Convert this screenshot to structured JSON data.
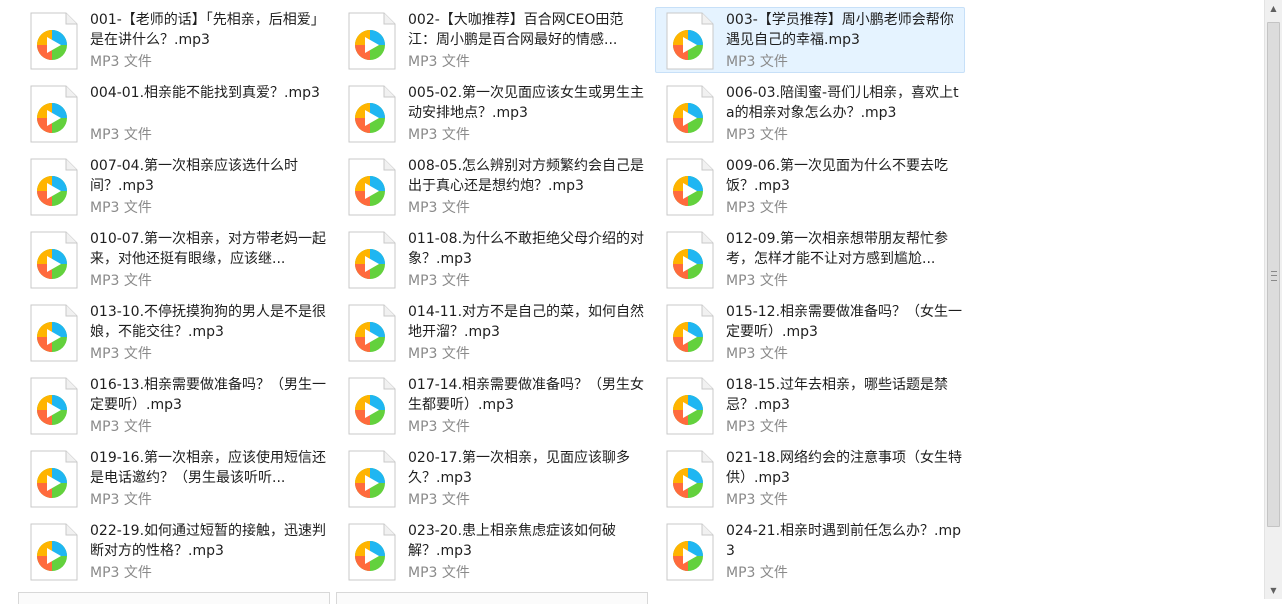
{
  "files": [
    {
      "name": "001-【老师的话】「先相亲，后相爱」是在讲什么？.mp3",
      "type": "MP3 文件",
      "selected": false
    },
    {
      "name": "002-【大咖推荐】百合网CEO田范江：周小鹏是百合网最好的情感...",
      "type": "MP3 文件",
      "selected": false
    },
    {
      "name": "003-【学员推荐】周小鹏老师会帮你遇见自己的幸福.mp3",
      "type": "MP3 文件",
      "selected": true
    },
    {
      "name": "004-01.相亲能不能找到真爱？.mp3",
      "type": "MP3 文件",
      "selected": false
    },
    {
      "name": "005-02.第一次见面应该女生或男生主动安排地点？.mp3",
      "type": "MP3 文件",
      "selected": false
    },
    {
      "name": "006-03.陪闺蜜-哥们儿相亲，喜欢上ta的相亲对象怎么办？.mp3",
      "type": "MP3 文件",
      "selected": false
    },
    {
      "name": "007-04.第一次相亲应该选什么时间？.mp3",
      "type": "MP3 文件",
      "selected": false
    },
    {
      "name": "008-05.怎么辨别对方频繁约会自己是出于真心还是想约炮？.mp3",
      "type": "MP3 文件",
      "selected": false
    },
    {
      "name": "009-06.第一次见面为什么不要去吃饭？.mp3",
      "type": "MP3 文件",
      "selected": false
    },
    {
      "name": "010-07.第一次相亲，对方带老妈一起来，对他还挺有眼缘，应该继...",
      "type": "MP3 文件",
      "selected": false
    },
    {
      "name": "011-08.为什么不敢拒绝父母介绍的对象？.mp3",
      "type": "MP3 文件",
      "selected": false
    },
    {
      "name": "012-09.第一次相亲想带朋友帮忙参考，怎样才能不让对方感到尴尬...",
      "type": "MP3 文件",
      "selected": false
    },
    {
      "name": "013-10.不停抚摸狗狗的男人是不是很娘，不能交往？.mp3",
      "type": "MP3 文件",
      "selected": false
    },
    {
      "name": "014-11.对方不是自己的菜，如何自然地开溜？.mp3",
      "type": "MP3 文件",
      "selected": false
    },
    {
      "name": "015-12.相亲需要做准备吗？（女生一定要听）.mp3",
      "type": "MP3 文件",
      "selected": false
    },
    {
      "name": "016-13.相亲需要做准备吗？（男生一定要听）.mp3",
      "type": "MP3 文件",
      "selected": false
    },
    {
      "name": "017-14.相亲需要做准备吗？（男生女生都要听）.mp3",
      "type": "MP3 文件",
      "selected": false
    },
    {
      "name": "018-15.过年去相亲，哪些话题是禁忌？.mp3",
      "type": "MP3 文件",
      "selected": false
    },
    {
      "name": "019-16.第一次相亲，应该使用短信还是电话邀约？（男生最该听听...",
      "type": "MP3 文件",
      "selected": false
    },
    {
      "name": "020-17.第一次相亲，见面应该聊多久？.mp3",
      "type": "MP3 文件",
      "selected": false
    },
    {
      "name": "021-18.网络约会的注意事项（女生特供）.mp3",
      "type": "MP3 文件",
      "selected": false
    },
    {
      "name": "022-19.如何通过短暂的接触，迅速判断对方的性格？.mp3",
      "type": "MP3 文件",
      "selected": false
    },
    {
      "name": "023-20.患上相亲焦虑症该如何破解？.mp3",
      "type": "MP3 文件",
      "selected": false
    },
    {
      "name": "024-21.相亲时遇到前任怎么办？.mp3",
      "type": "MP3 文件",
      "selected": false
    }
  ],
  "icons": {
    "file_icon": "video-player-file-icon",
    "play_colors": [
      "#1fb6f2",
      "#63d13d",
      "#ffb400",
      "#ff6a3d"
    ]
  },
  "scrollbar": {
    "position_fraction": 0.0
  }
}
